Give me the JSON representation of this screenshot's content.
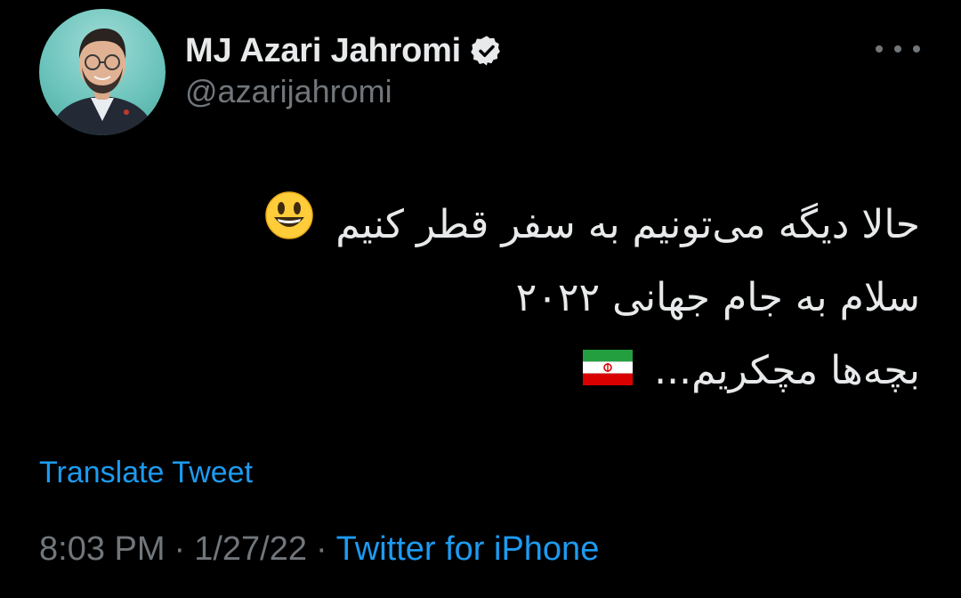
{
  "author": {
    "display_name": "MJ Azari Jahromi",
    "handle": "@azarijahromi",
    "verified_icon": "verified-badge-icon",
    "avatar_icon": "avatar"
  },
  "more_icon": "more-horizontal-icon",
  "tweet": {
    "lines": [
      "حالا دیگه می‌تونیم به سفر قطر کنیم",
      "سلام به جام جهانی ۲۰۲۲",
      "بچه‌ها مچکریم..."
    ],
    "emoji_line1": "smiling-face-emoji",
    "emoji_line3": "iran-flag-emoji"
  },
  "translate_label": "Translate Tweet",
  "meta": {
    "time": "8:03 PM",
    "separator": "·",
    "date": "1/27/22",
    "source": "Twitter for iPhone"
  },
  "colors": {
    "background": "#000000",
    "text": "#e7e9ea",
    "secondary": "#71767b",
    "link": "#1d9bf0"
  }
}
